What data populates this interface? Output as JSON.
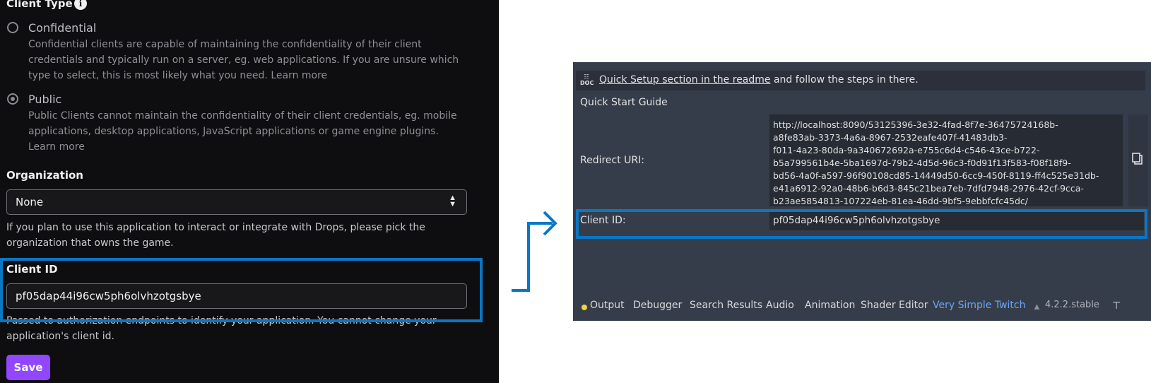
{
  "left_panel": {
    "client_type_title": "Client Type",
    "info_icon": "i",
    "confidential": {
      "label": "Confidential",
      "desc_lines": [
        "Confidential clients are capable of maintaining the confidentiality of their client",
        "credentials and typically run on a server, eg. web applications. If you are unsure which",
        "type to select, this is most likely what you need. Learn more"
      ]
    },
    "public": {
      "label": "Public",
      "desc_lines": [
        "Public Clients cannot maintain the confidentiality of their client credentials, eg. mobile",
        "applications, desktop applications, JavaScript applications or game engine plugins.",
        "Learn more"
      ]
    },
    "organization_title": "Organization",
    "organization_value": "None",
    "organization_help_lines": [
      "If you plan to use this application to interact or integrate with Drops, please pick the",
      "organization that owns the game."
    ],
    "client_id_title": "Client ID",
    "client_id_value": "pf05dap44i96cw5ph6olvhzotgsbye",
    "client_id_help_lines": [
      "Passed to authorization endpoints to identify your application. You cannot change your",
      "application's client id."
    ],
    "save_label": "Save"
  },
  "godot_panel": {
    "top_link": "Quick Setup section in the readme",
    "top_rest": " and follow the steps in there.",
    "doc_icon": "DOC",
    "quick_start": "Quick Start Guide",
    "redirect_label": "Redirect URI:",
    "redirect_lines": [
      "http://localhost:8090/53125396-3e32-4fad-8f7e-36475724168b-",
      "a8fe83ab-3373-4a6a-8967-2532eafe407f-41483db3-",
      "f011-4a23-80da-9a340672692a-e755c6d4-c546-43ce-b722-",
      "b5a799561b4e-5ba1697d-79b2-4d5d-96c3-f0d91f13f583-f08f18f9-",
      "bd56-4a0f-a597-96f90108cd85-14449d50-6cc9-450f-8119-ff4c525e31db-",
      "e41a6912-92a0-48b6-b6d3-845c21bea7eb-7dfd7948-2976-42cf-9cca-",
      "b23ae5854813-107224eb-81ea-46dd-9bf5-9ebbfcfc45dc/"
    ],
    "client_id_label": "Client ID:",
    "client_id_value": "pf05dap44i96cw5ph6olvhzotgsbye",
    "tabs": [
      "Output",
      "Debugger",
      "Search Results",
      "Audio",
      "Animation",
      "Shader Editor",
      "Very Simple Twitch"
    ],
    "version": "4.2.2.stable",
    "copy_icon": "copy-icon",
    "pin_icon": "panel-expand-icon"
  },
  "colors": {
    "highlight": "#0a77c4",
    "twitch_purple": "#9147ff",
    "godot_accent": "#6ba7f5"
  }
}
